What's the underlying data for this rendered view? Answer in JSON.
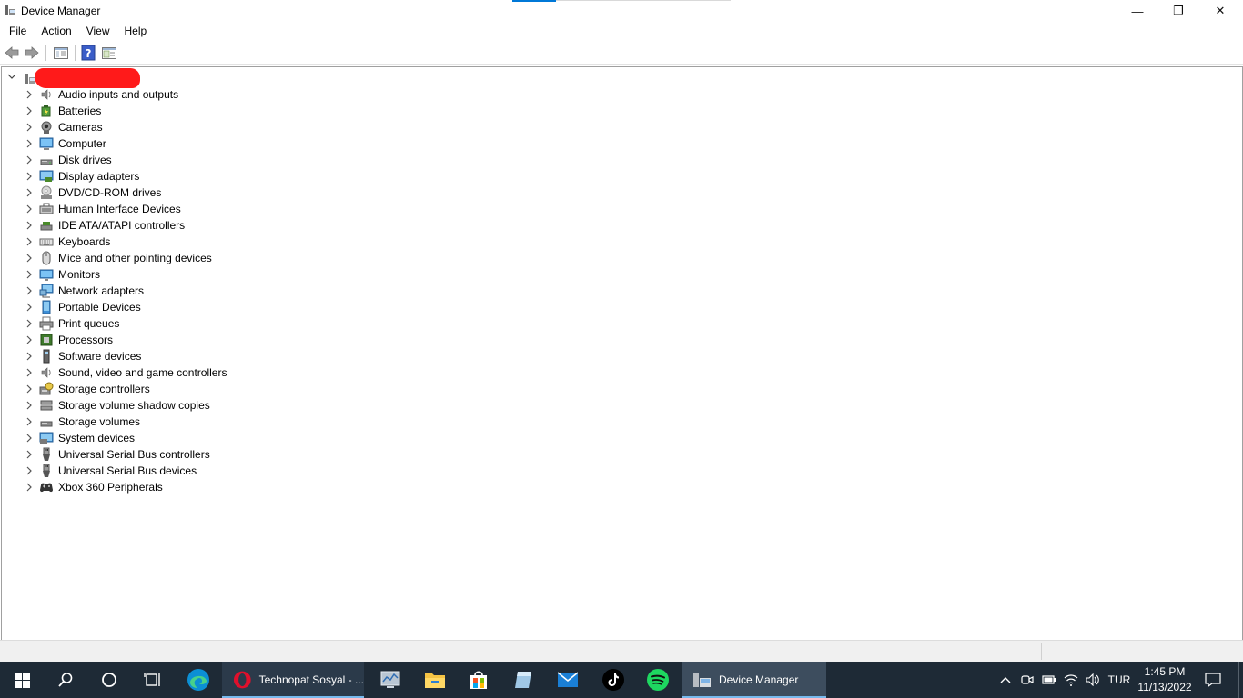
{
  "window": {
    "title": "Device Manager",
    "controls": {
      "minimize": "—",
      "maximize": "❐",
      "close": "✕"
    }
  },
  "menu": [
    "File",
    "Action",
    "View",
    "Help"
  ],
  "toolbar": {
    "buttons": [
      "back-arrow-icon",
      "forward-arrow-icon",
      "show-hide-console-tree-icon",
      "help-icon",
      "properties-icon"
    ]
  },
  "tree": {
    "root_label": "",
    "items": [
      {
        "label": "Audio inputs and outputs",
        "icon": "speaker-icon"
      },
      {
        "label": "Batteries",
        "icon": "battery-icon"
      },
      {
        "label": "Cameras",
        "icon": "camera-icon"
      },
      {
        "label": "Computer",
        "icon": "computer-icon"
      },
      {
        "label": "Disk drives",
        "icon": "disk-drive-icon"
      },
      {
        "label": "Display adapters",
        "icon": "display-adapter-icon"
      },
      {
        "label": "DVD/CD-ROM drives",
        "icon": "dvd-drive-icon"
      },
      {
        "label": "Human Interface Devices",
        "icon": "hid-icon"
      },
      {
        "label": "IDE ATA/ATAPI controllers",
        "icon": "ide-controller-icon"
      },
      {
        "label": "Keyboards",
        "icon": "keyboard-icon"
      },
      {
        "label": "Mice and other pointing devices",
        "icon": "mouse-icon"
      },
      {
        "label": "Monitors",
        "icon": "monitor-icon"
      },
      {
        "label": "Network adapters",
        "icon": "network-adapter-icon"
      },
      {
        "label": "Portable Devices",
        "icon": "portable-device-icon"
      },
      {
        "label": "Print queues",
        "icon": "printer-icon"
      },
      {
        "label": "Processors",
        "icon": "processor-icon"
      },
      {
        "label": "Software devices",
        "icon": "software-device-icon"
      },
      {
        "label": "Sound, video and game controllers",
        "icon": "sound-controller-icon"
      },
      {
        "label": "Storage controllers",
        "icon": "storage-controller-icon"
      },
      {
        "label": "Storage volume shadow copies",
        "icon": "shadow-copy-icon"
      },
      {
        "label": "Storage volumes",
        "icon": "storage-volume-icon"
      },
      {
        "label": "System devices",
        "icon": "system-device-icon"
      },
      {
        "label": "Universal Serial Bus controllers",
        "icon": "usb-icon"
      },
      {
        "label": "Universal Serial Bus devices",
        "icon": "usb-icon"
      },
      {
        "label": "Xbox 360 Peripherals",
        "icon": "gamepad-icon"
      }
    ]
  },
  "taskbar": {
    "pinned": [
      "start-icon",
      "search-icon",
      "cortana-icon",
      "task-view-icon",
      "edge-icon"
    ],
    "opera_label": "Technopat Sosyal - ...",
    "apps": [
      "system-monitor-icon",
      "file-explorer-icon",
      "store-icon",
      "notepad-icon",
      "mail-icon",
      "tiktok-icon",
      "spotify-icon"
    ],
    "active_label": "Device Manager",
    "tray": {
      "language": "TUR",
      "time": "1:45 PM",
      "date": "11/13/2022"
    }
  },
  "colors": {
    "taskbar_bg": "#1e2a36",
    "accent": "#0078d7",
    "redaction": "#ff1a1a"
  }
}
